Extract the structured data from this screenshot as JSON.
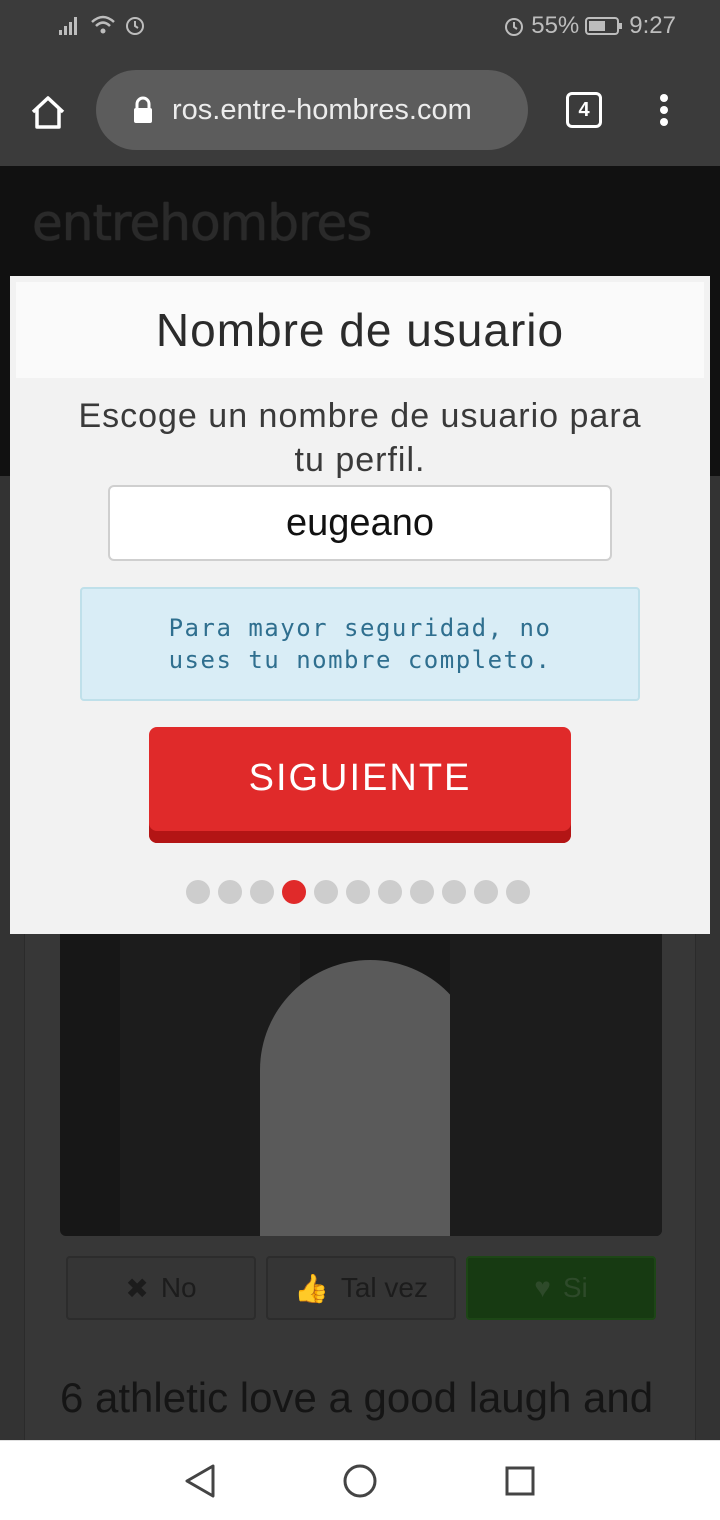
{
  "status_bar": {
    "alarm_icon": "alarm-icon",
    "battery_percent": "55%",
    "time": "9:27"
  },
  "browser": {
    "url": "ros.entre-hombres.com",
    "tab_count": "4"
  },
  "site": {
    "logo": "entrehombres"
  },
  "modal": {
    "title": "Nombre de usuario",
    "subtitle": "Escoge un nombre de usuario para tu perfil.",
    "username_value": "eugeano",
    "info_text": "Para mayor seguridad, no uses tu nombre completo.",
    "next_label": "SIGUIENTE",
    "steps_total": 11,
    "current_step": 4,
    "accent_color": "#e02a2a"
  },
  "profile": {
    "vote_no": "No",
    "vote_maybe": "Tal vez",
    "vote_yes": "Si",
    "bio": "6 athletic love a good laugh and"
  }
}
